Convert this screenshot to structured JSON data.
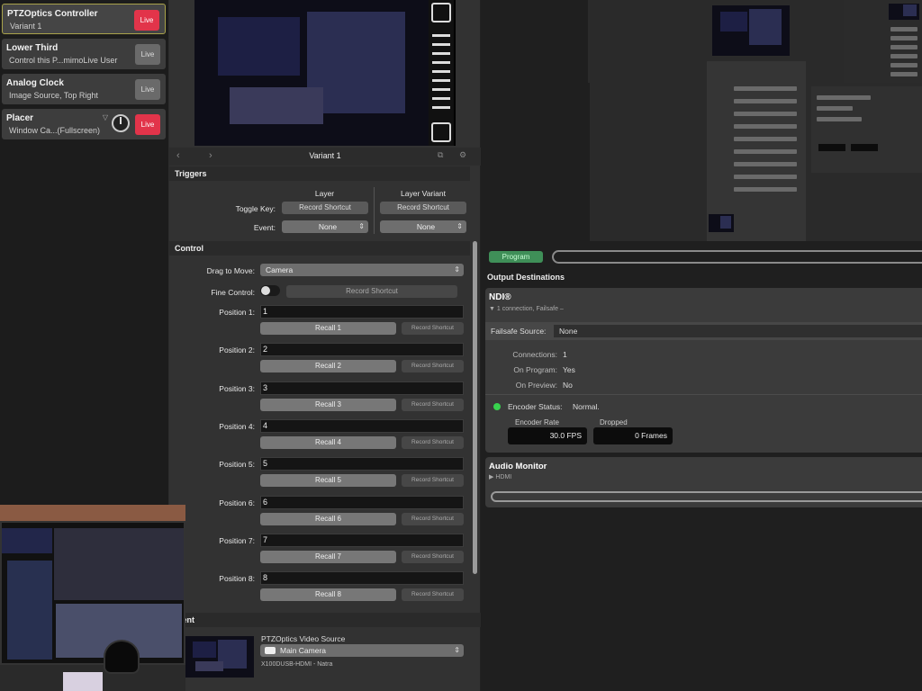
{
  "layers": [
    {
      "title": "PTZOptics Controller",
      "sub": "Variant 1",
      "live": "Live",
      "active": true
    },
    {
      "title": "Lower Third",
      "sub": "Control this P...mimoLive User",
      "live": "Live",
      "active": false
    },
    {
      "title": "Analog Clock",
      "sub": "Image Source, Top Right",
      "live": "Live",
      "active": false
    },
    {
      "title": "Placer",
      "sub": "Window Ca...(Fullscreen)",
      "live": "Live",
      "active": true
    }
  ],
  "variant": {
    "label": "Variant 1"
  },
  "triggers": {
    "heading": "Triggers",
    "col_layer": "Layer",
    "col_variant": "Layer Variant",
    "toggle_key_label": "Toggle Key:",
    "event_label": "Event:",
    "record_shortcut": "Record Shortcut",
    "event_value": "None"
  },
  "control": {
    "heading": "Control",
    "drag_label": "Drag to Move:",
    "drag_value": "Camera",
    "fine_label": "Fine Control:",
    "fine_shortcut": "Record Shortcut",
    "record_small": "Record Shortcut",
    "positions": [
      {
        "label": "Position 1:",
        "value": "1",
        "recall": "Recall 1"
      },
      {
        "label": "Position 2:",
        "value": "2",
        "recall": "Recall 2"
      },
      {
        "label": "Position 3:",
        "value": "3",
        "recall": "Recall 3"
      },
      {
        "label": "Position 4:",
        "value": "4",
        "recall": "Recall 4"
      },
      {
        "label": "Position 5:",
        "value": "5",
        "recall": "Recall 5"
      },
      {
        "label": "Position 6:",
        "value": "6",
        "recall": "Recall 6"
      },
      {
        "label": "Position 7:",
        "value": "7",
        "recall": "Recall 7"
      },
      {
        "label": "Position 8:",
        "value": "8",
        "recall": "Recall 8"
      }
    ]
  },
  "content": {
    "heading": "ntent",
    "source_label": "PTZOptics Video Source",
    "source_value": "Main Camera",
    "device": "X100DUSB-HDMI - Natra"
  },
  "output": {
    "program_label": "Program",
    "heading": "Output Destinations",
    "ndi_title": "NDI®",
    "ndi_sub": "▼ 1 connection, Failsafe –",
    "failsafe_label": "Failsafe Source:",
    "failsafe_value": "None",
    "connections_label": "Connections:",
    "connections_value": "1",
    "on_program_label": "On Program:",
    "on_program_value": "Yes",
    "on_preview_label": "On Preview:",
    "on_preview_value": "No",
    "encoder_status_label": "Encoder Status:",
    "encoder_status_value": "Normal.",
    "encoder_rate_label": "Encoder Rate",
    "encoder_rate_value": "30.0 FPS",
    "dropped_label": "Dropped",
    "dropped_value": "0 Frames",
    "status_color": "#38d24e"
  },
  "audio": {
    "heading": "Audio Monitor",
    "sub": "▶ HDMI"
  },
  "colors": {
    "live": "#e2344a",
    "accent_border": "#a8a24a",
    "program": "#3f8f58"
  }
}
